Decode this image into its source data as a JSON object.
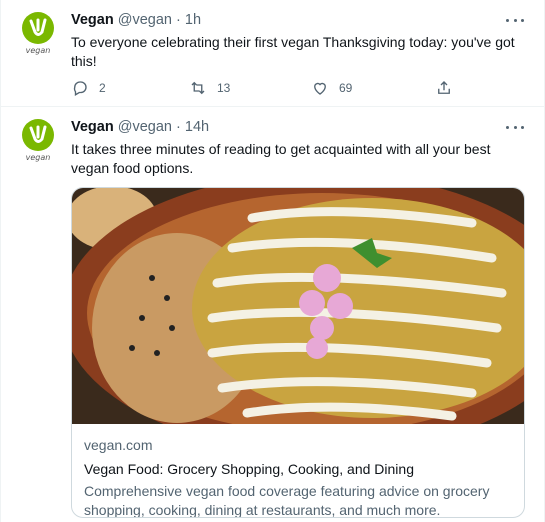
{
  "colors": {
    "brand": "#7ab800",
    "text": "#0f1419",
    "muted": "#536471",
    "border": "#cfd9de"
  },
  "tweets": [
    {
      "avatar_icon": "vegan-logo-icon",
      "avatar_text": "vegan",
      "name": "Vegan",
      "handle": "@vegan",
      "sep": "·",
      "time": "1h",
      "text": "To everyone celebrating their first vegan Thanksgiving today: you've got this!",
      "replies": "2",
      "retweets": "13",
      "likes": "69"
    },
    {
      "avatar_icon": "vegan-logo-icon",
      "avatar_text": "vegan",
      "name": "Vegan",
      "handle": "@vegan",
      "sep": "·",
      "time": "14h",
      "text": "It takes three minutes of reading to get acquainted with all your best vegan food options.",
      "card": {
        "image_icon": "enchiladas-photo",
        "domain": "vegan.com",
        "title": "Vegan Food: Grocery Shopping, Cooking, and Dining",
        "description": "Comprehensive vegan food coverage featuring advice on grocery shopping, cooking, dining at restaurants, and much more."
      }
    }
  ],
  "icons": {
    "reply": "reply-icon",
    "retweet": "retweet-icon",
    "like": "heart-icon",
    "share": "share-icon",
    "more": "more-icon"
  }
}
